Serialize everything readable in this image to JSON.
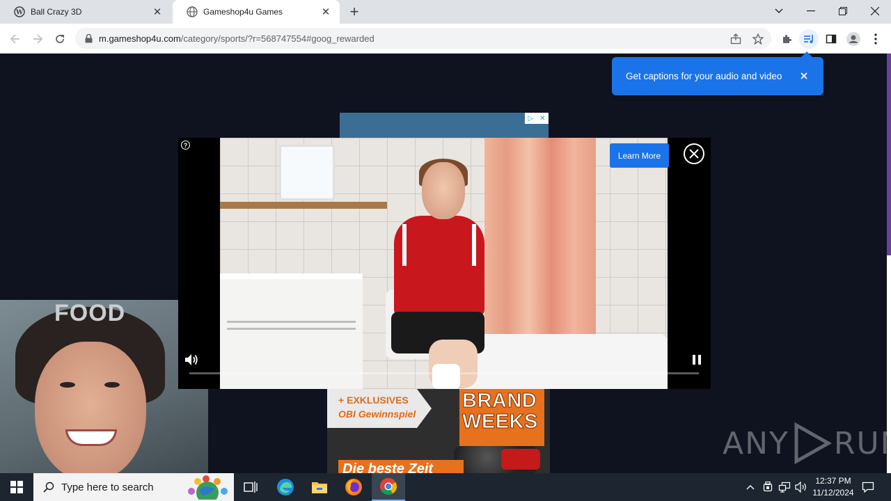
{
  "browser": {
    "tabs": [
      {
        "title": "Ball Crazy 3D",
        "favicon": "wordpress-icon",
        "active": false
      },
      {
        "title": "Gameshop4u Games",
        "favicon": "globe-icon",
        "active": true
      }
    ],
    "address": {
      "host": "m.gameshop4u.com",
      "path": "/category/sports/?r=568747554#goog_rewarded"
    }
  },
  "caption_bubble": {
    "text": "Get captions for your audio and video"
  },
  "video_ad": {
    "learn_more_label": "Learn More",
    "info_glyph": "?",
    "progress": 0.0
  },
  "background_ads": {
    "food_ad": {
      "label": "FOOD"
    },
    "obi_ad": {
      "line1": "+ EXKLUSIVES",
      "line2": "OBI Gewinnspiel",
      "brand_line1": "BRAND",
      "brand_line2": "WEEKS",
      "bottom": "Die beste Zeit"
    }
  },
  "watermark": {
    "left": "ANY",
    "right": "RUN"
  },
  "taskbar": {
    "search_placeholder": "Type here to search",
    "time": "12:37 PM",
    "date": "11/12/2024"
  },
  "colors": {
    "accent": "#1a73e8",
    "page_bg": "#0f1320",
    "taskbar_bg": "#1c2530"
  }
}
